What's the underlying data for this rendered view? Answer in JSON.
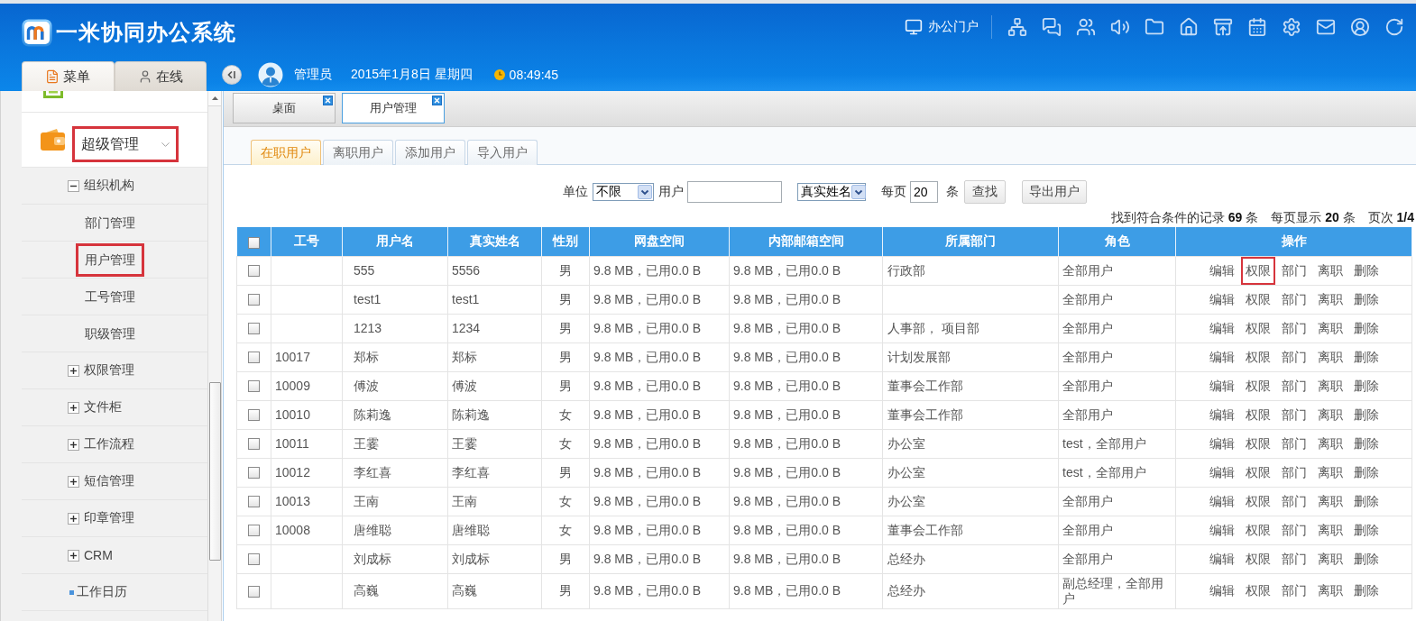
{
  "app": {
    "title": "一米协同办公系统"
  },
  "header": {
    "portal_link": "办公门户",
    "user": "管理员",
    "date": "2015年1月8日 星期四",
    "time": "08:49:45"
  },
  "sidebar": {
    "tabs": [
      {
        "label": "菜单",
        "selected": true
      },
      {
        "label": "在线",
        "selected": false
      }
    ],
    "items": [
      {
        "kind": "module_cut"
      },
      {
        "kind": "module",
        "label": "超级管理",
        "expanded": true,
        "highlighted": true,
        "children": [
          {
            "kind": "folder",
            "label": "组织机构",
            "expanded": true,
            "children": [
              {
                "kind": "page",
                "label": "部门管理",
                "highlighted": false
              },
              {
                "kind": "page",
                "label": "用户管理",
                "highlighted": true
              },
              {
                "kind": "page",
                "label": "工号管理",
                "highlighted": false
              },
              {
                "kind": "page",
                "label": "职级管理",
                "highlighted": false
              }
            ]
          },
          {
            "kind": "folder",
            "label": "权限管理",
            "expanded": false
          },
          {
            "kind": "folder",
            "label": "文件柜",
            "expanded": false
          },
          {
            "kind": "folder",
            "label": "工作流程",
            "expanded": false
          },
          {
            "kind": "folder",
            "label": "短信管理",
            "expanded": false
          },
          {
            "kind": "folder",
            "label": "印章管理",
            "expanded": false
          },
          {
            "kind": "folder",
            "label": "CRM",
            "expanded": false
          },
          {
            "kind": "leaf",
            "label": "工作日历"
          }
        ]
      }
    ]
  },
  "tabs": [
    {
      "label": "桌面",
      "selected": false
    },
    {
      "label": "用户管理",
      "selected": true
    }
  ],
  "subtabs": [
    {
      "label": "在职用户",
      "selected": true
    },
    {
      "label": "离职用户",
      "selected": false
    },
    {
      "label": "添加用户",
      "selected": false
    },
    {
      "label": "导入用户",
      "selected": false
    }
  ],
  "filter": {
    "unit_label": "单位",
    "unit_value": "不限",
    "user_label": "用户",
    "field_value": "真实姓名",
    "per_page_label": "每页",
    "per_page_value": "20",
    "per_page_unit": "条",
    "search_button": "查找",
    "export_button": "导出用户"
  },
  "summary": [
    "找到符合条件的记录 **69** 条",
    "每页显示 **20** 条",
    "页次 **1/4**"
  ],
  "table": {
    "all_checked": false,
    "columns": [
      "工号",
      "用户名",
      "真实姓名",
      "性别",
      "网盘空间",
      "内部邮箱空间",
      "所属部门",
      "角色",
      "操作"
    ],
    "rows": [
      {
        "checked": false,
        "username": "555",
        "real_name": "5556",
        "gender": "男",
        "disk": "9.8 MB，已用0.0 B",
        "mailbox": "9.8 MB，已用0.0 B",
        "department": "行政部",
        "role": "全部用户",
        "actions": [
          {
            "label": "编辑",
            "highlighted": false
          },
          {
            "label": "权限",
            "highlighted": true
          },
          {
            "label": "部门",
            "highlighted": false
          },
          {
            "label": "离职",
            "highlighted": false
          },
          {
            "label": "删除",
            "highlighted": false
          }
        ]
      },
      {
        "checked": false,
        "username": "test1",
        "real_name": "test1",
        "gender": "男",
        "disk": "9.8 MB，已用0.0 B",
        "mailbox": "9.8 MB，已用0.0 B",
        "role": "全部用户",
        "actions": [
          {
            "label": "编辑",
            "highlighted": false
          },
          {
            "label": "权限",
            "highlighted": false
          },
          {
            "label": "部门",
            "highlighted": false
          },
          {
            "label": "离职",
            "highlighted": false
          },
          {
            "label": "删除",
            "highlighted": false
          }
        ]
      },
      {
        "checked": false,
        "username": "1213",
        "real_name": "1234",
        "gender": "男",
        "disk": "9.8 MB，已用0.0 B",
        "mailbox": "9.8 MB，已用0.0 B",
        "department": "人事部， 项目部",
        "role": "全部用户",
        "actions": [
          {
            "label": "编辑",
            "highlighted": false
          },
          {
            "label": "权限",
            "highlighted": false
          },
          {
            "label": "部门",
            "highlighted": false
          },
          {
            "label": "离职",
            "highlighted": false
          },
          {
            "label": "删除",
            "highlighted": false
          }
        ]
      },
      {
        "checked": false,
        "employee_no": "10017",
        "username": "郑标",
        "real_name": "郑标",
        "gender": "男",
        "disk": "9.8 MB，已用0.0 B",
        "mailbox": "9.8 MB，已用0.0 B",
        "department": "计划发展部",
        "role": "全部用户",
        "actions": [
          {
            "label": "编辑",
            "highlighted": false
          },
          {
            "label": "权限",
            "highlighted": false
          },
          {
            "label": "部门",
            "highlighted": false
          },
          {
            "label": "离职",
            "highlighted": false
          },
          {
            "label": "删除",
            "highlighted": false
          }
        ]
      },
      {
        "checked": false,
        "employee_no": "10009",
        "username": "傅波",
        "real_name": "傅波",
        "gender": "男",
        "disk": "9.8 MB，已用0.0 B",
        "mailbox": "9.8 MB，已用0.0 B",
        "department": "董事会工作部",
        "role": "全部用户",
        "actions": [
          {
            "label": "编辑",
            "highlighted": false
          },
          {
            "label": "权限",
            "highlighted": false
          },
          {
            "label": "部门",
            "highlighted": false
          },
          {
            "label": "离职",
            "highlighted": false
          },
          {
            "label": "删除",
            "highlighted": false
          }
        ]
      },
      {
        "checked": false,
        "employee_no": "10010",
        "username": "陈莉逸",
        "real_name": "陈莉逸",
        "gender": "女",
        "disk": "9.8 MB，已用0.0 B",
        "mailbox": "9.8 MB，已用0.0 B",
        "department": "董事会工作部",
        "role": "全部用户",
        "actions": [
          {
            "label": "编辑",
            "highlighted": false
          },
          {
            "label": "权限",
            "highlighted": false
          },
          {
            "label": "部门",
            "highlighted": false
          },
          {
            "label": "离职",
            "highlighted": false
          },
          {
            "label": "删除",
            "highlighted": false
          }
        ]
      },
      {
        "checked": false,
        "employee_no": "10011",
        "username": "王霎",
        "real_name": "王霎",
        "gender": "女",
        "disk": "9.8 MB，已用0.0 B",
        "mailbox": "9.8 MB，已用0.0 B",
        "department": "办公室",
        "role": "test，全部用户",
        "actions": [
          {
            "label": "编辑",
            "highlighted": false
          },
          {
            "label": "权限",
            "highlighted": false
          },
          {
            "label": "部门",
            "highlighted": false
          },
          {
            "label": "离职",
            "highlighted": false
          },
          {
            "label": "删除",
            "highlighted": false
          }
        ]
      },
      {
        "checked": false,
        "employee_no": "10012",
        "username": "李红喜",
        "real_name": "李红喜",
        "gender": "男",
        "disk": "9.8 MB，已用0.0 B",
        "mailbox": "9.8 MB，已用0.0 B",
        "department": "办公室",
        "role": "test，全部用户",
        "actions": [
          {
            "label": "编辑",
            "highlighted": false
          },
          {
            "label": "权限",
            "highlighted": false
          },
          {
            "label": "部门",
            "highlighted": false
          },
          {
            "label": "离职",
            "highlighted": false
          },
          {
            "label": "删除",
            "highlighted": false
          }
        ]
      },
      {
        "checked": false,
        "employee_no": "10013",
        "username": "王南",
        "real_name": "王南",
        "gender": "女",
        "disk": "9.8 MB，已用0.0 B",
        "mailbox": "9.8 MB，已用0.0 B",
        "department": "办公室",
        "role": "全部用户",
        "actions": [
          {
            "label": "编辑",
            "highlighted": false
          },
          {
            "label": "权限",
            "highlighted": false
          },
          {
            "label": "部门",
            "highlighted": false
          },
          {
            "label": "离职",
            "highlighted": false
          },
          {
            "label": "删除",
            "highlighted": false
          }
        ]
      },
      {
        "checked": false,
        "employee_no": "10008",
        "username": "唐维聪",
        "real_name": "唐维聪",
        "gender": "女",
        "disk": "9.8 MB，已用0.0 B",
        "mailbox": "9.8 MB，已用0.0 B",
        "department": "董事会工作部",
        "role": "全部用户",
        "actions": [
          {
            "label": "编辑",
            "highlighted": false
          },
          {
            "label": "权限",
            "highlighted": false
          },
          {
            "label": "部门",
            "highlighted": false
          },
          {
            "label": "离职",
            "highlighted": false
          },
          {
            "label": "删除",
            "highlighted": false
          }
        ]
      },
      {
        "checked": false,
        "username": "刘成标",
        "real_name": "刘成标",
        "gender": "男",
        "disk": "9.8 MB，已用0.0 B",
        "mailbox": "9.8 MB，已用0.0 B",
        "department": "总经办",
        "role": "全部用户",
        "actions": [
          {
            "label": "编辑",
            "highlighted": false
          },
          {
            "label": "权限",
            "highlighted": false
          },
          {
            "label": "部门",
            "highlighted": false
          },
          {
            "label": "离职",
            "highlighted": false
          },
          {
            "label": "删除",
            "highlighted": false
          }
        ]
      },
      {
        "checked": false,
        "username": "高巍",
        "real_name": "高巍",
        "gender": "男",
        "disk": "9.8 MB，已用0.0 B",
        "mailbox": "9.8 MB，已用0.0 B",
        "department": "总经办",
        "role": "副总经理，全部用户",
        "actions": [
          {
            "label": "编辑",
            "highlighted": false
          },
          {
            "label": "权限",
            "highlighted": false
          },
          {
            "label": "部门",
            "highlighted": false
          },
          {
            "label": "离职",
            "highlighted": false
          },
          {
            "label": "删除",
            "highlighted": false
          }
        ]
      }
    ]
  }
}
